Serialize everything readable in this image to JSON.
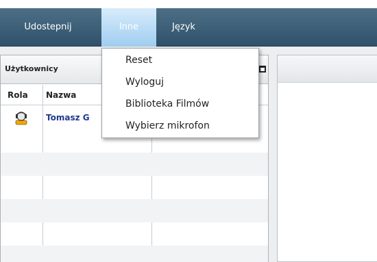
{
  "menubar": {
    "items": [
      {
        "label": "Udostepnij"
      },
      {
        "label": "Inne"
      },
      {
        "label": "Język"
      }
    ]
  },
  "dropdown": {
    "items": [
      {
        "label": "Reset"
      },
      {
        "label": "Wyloguj"
      },
      {
        "label": "Biblioteka Filmów"
      },
      {
        "label": "Wybierz mikrofon"
      }
    ]
  },
  "users_panel": {
    "title": "Użytkownicy",
    "columns": [
      "Rola",
      "Nazwa"
    ],
    "rows": [
      {
        "role_icon": "moderator-avatar-icon",
        "name": "Tomasz G"
      }
    ]
  },
  "colors": {
    "menubar": "#3d6078",
    "menubar_active": "#b8dcf6",
    "user_name": "#1f3a8c"
  }
}
